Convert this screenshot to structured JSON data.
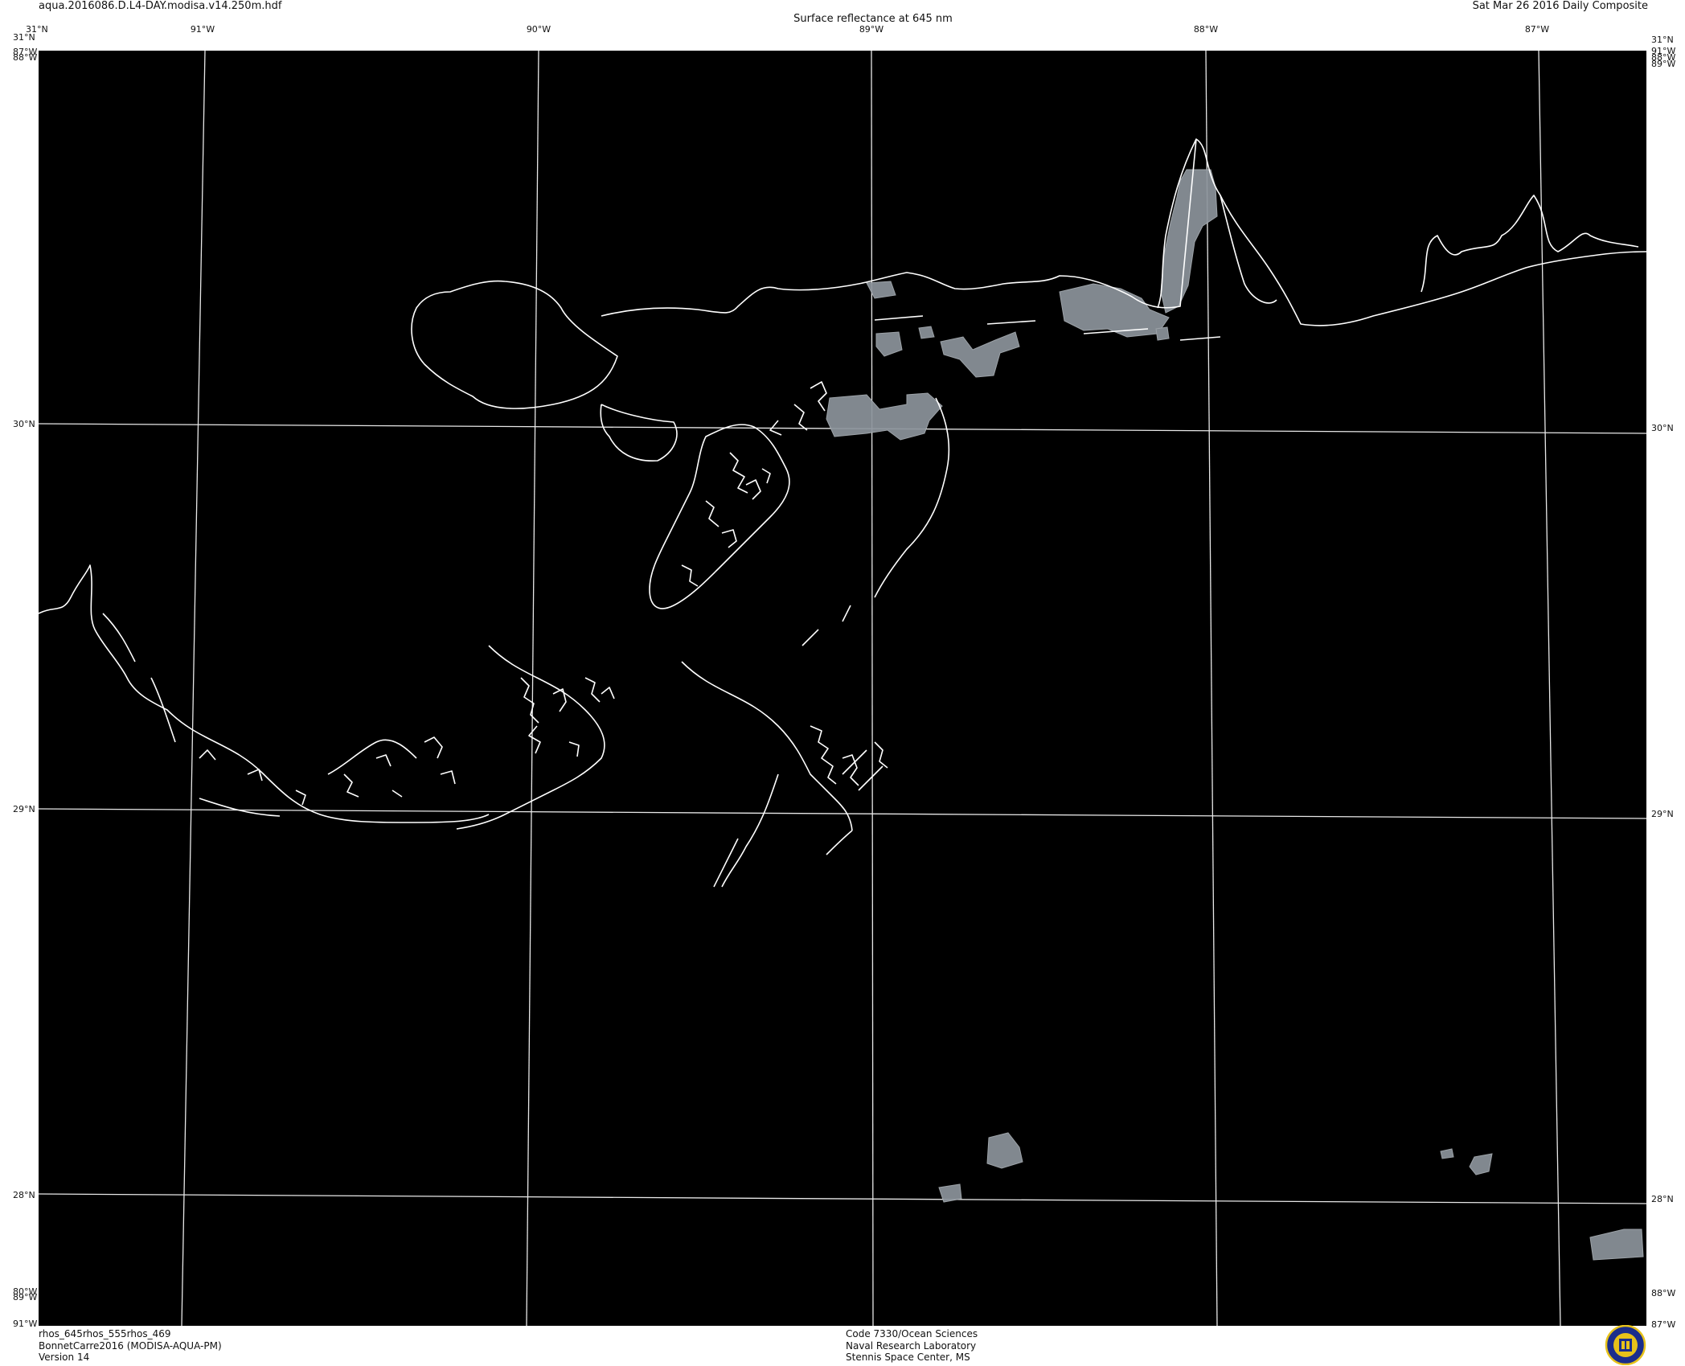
{
  "header": {
    "filename": "aqua.2016086.D.L4-DAY.modisa.v14.250m.hdf",
    "product_title": "Surface reflectance at 645 nm",
    "date_composite": "Sat Mar 26 2016 Daily Composite"
  },
  "graticule": {
    "top_lon_labels": [
      "91°W",
      "90°W",
      "89°W",
      "88°W",
      "87°W"
    ],
    "left_lat_labels": [
      "30°N",
      "29°N",
      "28°N"
    ],
    "right_lat_labels": [
      "30°N",
      "29°N",
      "28°N"
    ],
    "corner_top_left": [
      "31°N",
      "31°N",
      "87°W",
      "88°W"
    ],
    "corner_top_right": [
      "31°N",
      "91°W",
      "88°W",
      "89°W"
    ],
    "corner_bottom_left": [
      "80°W",
      "89°W",
      "91°W"
    ],
    "corner_bottom_right": [
      "88°W",
      "87°W"
    ]
  },
  "footer": {
    "left": [
      "rhos_645rhos_555rhos_469",
      "BonnetCarre2016 (MODISA-AQUA-PM)",
      "Version 14"
    ],
    "center": [
      "Code 7330/Ocean Sciences",
      "Naval Research Laboratory",
      "Stennis Space Center, MS"
    ]
  },
  "colors": {
    "background": "#000000",
    "coastline": "#ffffff",
    "gridline": "#e8e8e8",
    "cloud": "#8c949c",
    "logo_blue": "#1a2d8c",
    "logo_gold": "#e7c21a"
  },
  "icons": {
    "logo": "nrl-seal-icon"
  }
}
